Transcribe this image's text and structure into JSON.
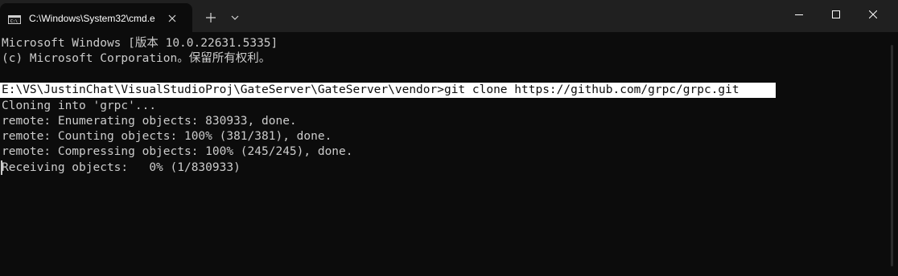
{
  "tab": {
    "title": "C:\\Windows\\System32\\cmd.e",
    "icon": "cmd-icon"
  },
  "tabbar": {
    "new_tab_icon": "plus-icon",
    "dropdown_icon": "chevron-down-icon"
  },
  "window_controls": {
    "minimize_icon": "minimize-icon",
    "maximize_icon": "maximize-icon",
    "close_icon": "close-icon"
  },
  "terminal": {
    "lines": [
      "Microsoft Windows [版本 10.0.22631.5335]",
      "(c) Microsoft Corporation。保留所有权利。",
      "",
      "E:\\VS\\JustinChat\\VisualStudioProj\\GateServer\\GateServer\\vendor>git clone https://github.com/grpc/grpc.git",
      "Cloning into 'grpc'...",
      "remote: Enumerating objects: 830933, done.",
      "remote: Counting objects: 100% (381/381), done.",
      "remote: Compressing objects: 100% (245/245), done.",
      "Receiving objects:   0% (1/830933)"
    ]
  },
  "colors": {
    "background": "#0c0c0c",
    "tabbar": "#202020",
    "text": "#cccccc",
    "selection": "#ffffff"
  }
}
